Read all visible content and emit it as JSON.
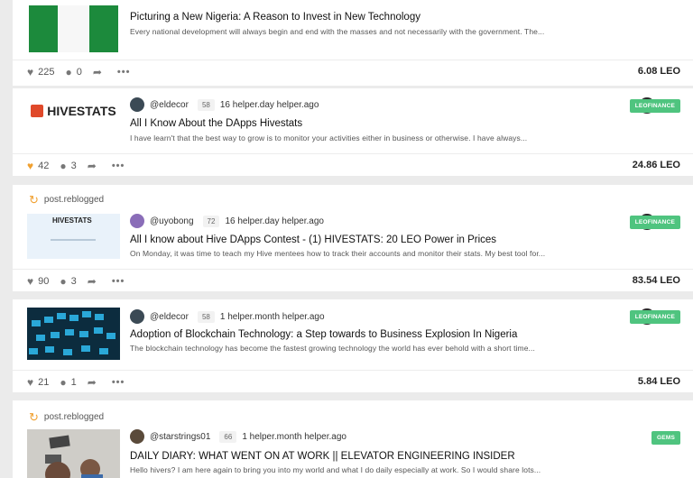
{
  "posts": [
    {
      "title": "Picturing a New Nigeria: A Reason to Invest in New Technology",
      "excerpt": "Every national development will always begin and end with the masses and not necessarily with the government. The...",
      "votes": "225",
      "comments": "0",
      "payout": "6.08 LEO"
    },
    {
      "author": "@eldecor",
      "rep": "58",
      "time": "16 helper.day helper.ago",
      "title": "All I Know About the DApps Hivestats",
      "excerpt": "I have learn't that the best way to grow is to monitor your activities either in business or otherwise. I have always...",
      "tag": "LEOFINANCE",
      "thumb_text": "HIVESTATS",
      "votes": "42",
      "comments": "3",
      "payout": "24.86 LEO"
    },
    {
      "reblog": "post.reblogged",
      "author": "@uyobong",
      "rep": "72",
      "time": "16 helper.day helper.ago",
      "title": "All I know about Hive DApps Contest - (1) HIVESTATS: 20 LEO Power in Prices",
      "excerpt": "On Monday, it was time to teach my Hive mentees how to track their accounts and monitor their stats. My best tool for...",
      "tag": "LEOFINANCE",
      "thumb_text": "HIVESTATS",
      "votes": "90",
      "comments": "3",
      "payout": "83.54 LEO"
    },
    {
      "author": "@eldecor",
      "rep": "58",
      "time": "1 helper.month helper.ago",
      "title": "Adoption of Blockchain Technology: a Step towards to Business Explosion In Nigeria",
      "excerpt": "The blockchain technology has become the fastest growing technology the world has ever behold with a short time...",
      "tag": "LEOFINANCE",
      "votes": "21",
      "comments": "1",
      "payout": "5.84 LEO"
    },
    {
      "reblog": "post.reblogged",
      "author": "@starstrings01",
      "rep": "66",
      "time": "1 helper.month helper.ago",
      "title": "DAILY DIARY: WHAT WENT ON AT WORK || ELEVATOR ENGINEERING INSIDER",
      "excerpt": "Hello hivers? I am here again to bring you into my world and what I do daily especially at work. So I would share lots...",
      "tag": "GEMS"
    }
  ],
  "colors": {
    "tag_green": "#4fc47f",
    "reblog_orange": "#f0a030",
    "liked_heart": "#f0a030"
  }
}
